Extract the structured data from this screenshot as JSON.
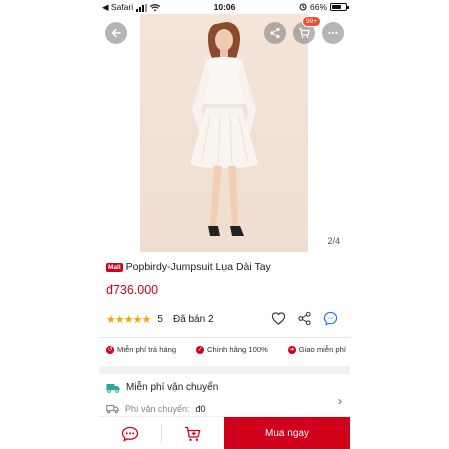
{
  "status_bar": {
    "back_app": "◀ Safari",
    "time": "10:06",
    "battery": "66%",
    "battery_level": 0.66
  },
  "gallery": {
    "pager": "2/4",
    "cart_badge": "99+"
  },
  "product": {
    "badge": "Mall",
    "title": "Popbirdy-Jumpsuit Lụa Dài Tay",
    "price": "đ736.000",
    "rating": "5",
    "rating_stars": 5,
    "sold": "Đã bán 2"
  },
  "guarantees": [
    {
      "label": "Miễn phí trả hàng",
      "icon": "return-icon"
    },
    {
      "label": "Chính hãng 100%",
      "icon": "shield-check-icon"
    },
    {
      "label": "Giao miễn phí",
      "icon": "truck-icon"
    }
  ],
  "shipping": {
    "title": "Miễn phí vận chuyển",
    "fee_label": "Phí vận chuyển:",
    "fee_value": "đ0"
  },
  "bottom_bar": {
    "buy_now": "Mua ngay"
  },
  "colors": {
    "accent": "#d0011b",
    "star": "#f6a700",
    "free_ship": "#26aa99"
  }
}
